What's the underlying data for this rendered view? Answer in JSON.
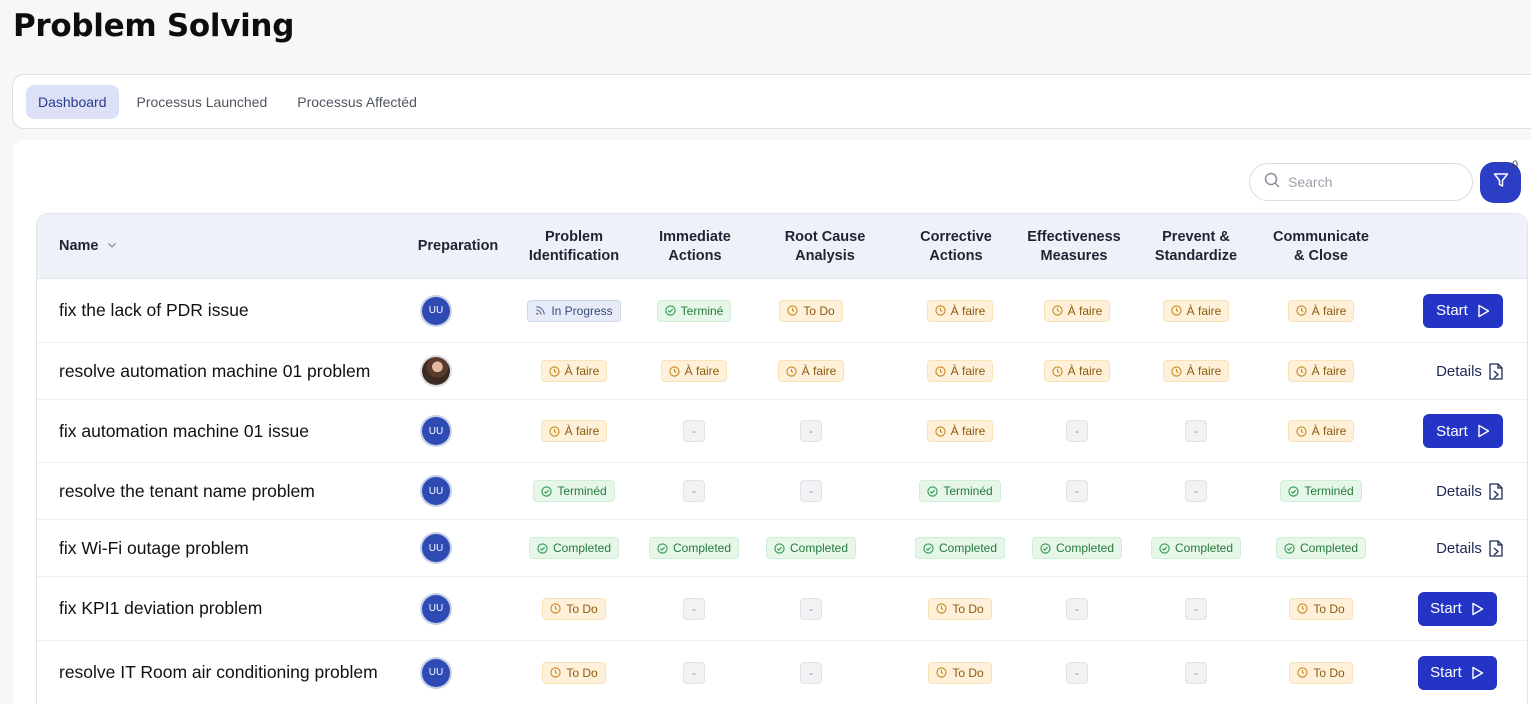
{
  "page": {
    "title": "Problem Solving"
  },
  "tabs": [
    {
      "label": "Dashboard",
      "active": true
    },
    {
      "label": "Processus Launched",
      "active": false
    },
    {
      "label": "Processus Affectéd",
      "active": false
    }
  ],
  "search": {
    "placeholder": "Search",
    "value": ""
  },
  "filter": {
    "count": "0",
    "icon": "filter-icon"
  },
  "table": {
    "columns": [
      "Name",
      "Preparation",
      "Problem\nIdentification",
      "Immediate\nActions",
      "Root Cause\nAnalysis",
      "Corrective\nActions",
      "Effectiveness\nMeasures",
      "Prevent &\nStandardize",
      "Communicate\n& Close"
    ],
    "rows": [
      {
        "name": "fix the lack of PDR issue",
        "avatar": "UU",
        "stages": [
          {
            "status": "progress",
            "label": "In Progress"
          },
          {
            "status": "done",
            "label": "Terminé"
          },
          {
            "status": "todo",
            "label": "To Do"
          },
          {
            "status": "todo",
            "label": "À faire"
          },
          {
            "status": "todo",
            "label": "À faire"
          },
          {
            "status": "todo",
            "label": "À faire"
          },
          {
            "status": "todo",
            "label": "À faire"
          }
        ],
        "action": {
          "type": "start",
          "label": "Start"
        }
      },
      {
        "name": "resolve automation machine 01 problem",
        "avatar": "",
        "stages": [
          {
            "status": "todo",
            "label": "À faire"
          },
          {
            "status": "todo",
            "label": "À faire"
          },
          {
            "status": "todo",
            "label": "À faire"
          },
          {
            "status": "todo",
            "label": "À faire"
          },
          {
            "status": "todo",
            "label": "À faire"
          },
          {
            "status": "todo",
            "label": "À faire"
          },
          {
            "status": "todo",
            "label": "À faire"
          }
        ],
        "action": {
          "type": "details",
          "label": "Details"
        }
      },
      {
        "name": "fix automation machine 01 issue",
        "avatar": "UU",
        "stages": [
          {
            "status": "todo",
            "label": "À faire"
          },
          {
            "status": "empty",
            "label": "-"
          },
          {
            "status": "empty",
            "label": "-"
          },
          {
            "status": "todo",
            "label": "À faire"
          },
          {
            "status": "empty",
            "label": "-"
          },
          {
            "status": "empty",
            "label": "-"
          },
          {
            "status": "todo",
            "label": "À faire"
          }
        ],
        "action": {
          "type": "start",
          "label": "Start"
        }
      },
      {
        "name": "resolve the tenant name problem",
        "avatar": "UU",
        "stages": [
          {
            "status": "done",
            "label": "Terminéd"
          },
          {
            "status": "empty",
            "label": "-"
          },
          {
            "status": "empty",
            "label": "-"
          },
          {
            "status": "done",
            "label": "Terminéd"
          },
          {
            "status": "empty",
            "label": "-"
          },
          {
            "status": "empty",
            "label": "-"
          },
          {
            "status": "done",
            "label": "Terminéd"
          }
        ],
        "action": {
          "type": "details",
          "label": "Details"
        }
      },
      {
        "name": "fix Wi-Fi outage problem",
        "avatar": "UU",
        "stages": [
          {
            "status": "done",
            "label": "Completed"
          },
          {
            "status": "done",
            "label": "Completed"
          },
          {
            "status": "done",
            "label": "Completed"
          },
          {
            "status": "done",
            "label": "Completed"
          },
          {
            "status": "done",
            "label": "Completed"
          },
          {
            "status": "done",
            "label": "Completed"
          },
          {
            "status": "done",
            "label": "Completed"
          }
        ],
        "action": {
          "type": "details",
          "label": "Details"
        }
      },
      {
        "name": "fix KPI1 deviation problem",
        "avatar": "UU",
        "stages": [
          {
            "status": "todo",
            "label": "To Do"
          },
          {
            "status": "empty",
            "label": "-"
          },
          {
            "status": "empty",
            "label": "-"
          },
          {
            "status": "todo",
            "label": "To Do"
          },
          {
            "status": "empty",
            "label": "-"
          },
          {
            "status": "empty",
            "label": "-"
          },
          {
            "status": "todo",
            "label": "To Do"
          }
        ],
        "action": {
          "type": "start",
          "label": "Start"
        }
      },
      {
        "name": "resolve IT Room air conditioning problem",
        "avatar": "UU",
        "stages": [
          {
            "status": "todo",
            "label": "To Do"
          },
          {
            "status": "empty",
            "label": "-"
          },
          {
            "status": "empty",
            "label": "-"
          },
          {
            "status": "todo",
            "label": "To Do"
          },
          {
            "status": "empty",
            "label": "-"
          },
          {
            "status": "empty",
            "label": "-"
          },
          {
            "status": "todo",
            "label": "To Do"
          }
        ],
        "action": {
          "type": "start",
          "label": "Start"
        }
      }
    ]
  },
  "colors": {
    "primary": "#2434c5",
    "todo_bg": "#fff1d9",
    "done_bg": "#e6f7ea",
    "progress_bg": "#e7ebf7"
  }
}
